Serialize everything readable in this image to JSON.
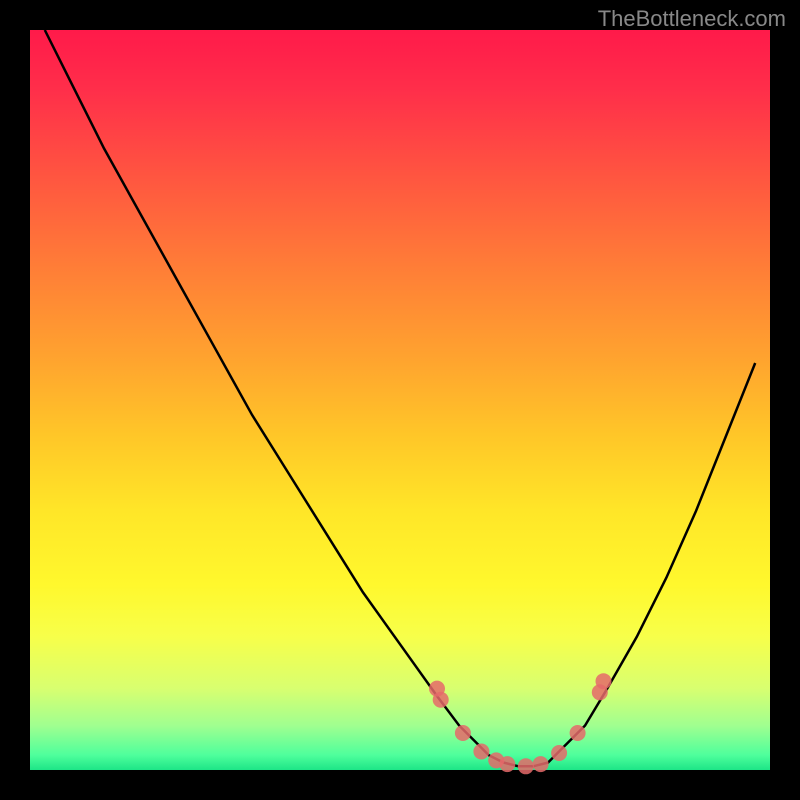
{
  "watermark": "TheBottleneck.com",
  "chart_data": {
    "type": "line",
    "title": "",
    "xlabel": "",
    "ylabel": "",
    "xlim": [
      0,
      100
    ],
    "ylim": [
      0,
      100
    ],
    "series": [
      {
        "name": "curve",
        "x": [
          2,
          5,
          10,
          15,
          20,
          25,
          30,
          35,
          40,
          45,
          50,
          55,
          58,
          60,
          62,
          64,
          66,
          68,
          70,
          72,
          75,
          78,
          82,
          86,
          90,
          94,
          98
        ],
        "y": [
          100,
          94,
          84,
          75,
          66,
          57,
          48,
          40,
          32,
          24,
          17,
          10,
          6,
          4,
          2,
          1,
          0.5,
          0.5,
          1,
          3,
          6,
          11,
          18,
          26,
          35,
          45,
          55
        ]
      }
    ],
    "markers": {
      "name": "dots",
      "x": [
        55,
        55.5,
        58.5,
        61,
        63,
        64.5,
        67,
        69,
        71.5,
        74,
        77,
        77.5
      ],
      "y": [
        11,
        9.5,
        5,
        2.5,
        1.3,
        0.8,
        0.5,
        0.8,
        2.3,
        5,
        10.5,
        12
      ]
    },
    "background_gradient": {
      "top": "#ff1a4a",
      "bottom": "#1de587"
    }
  }
}
